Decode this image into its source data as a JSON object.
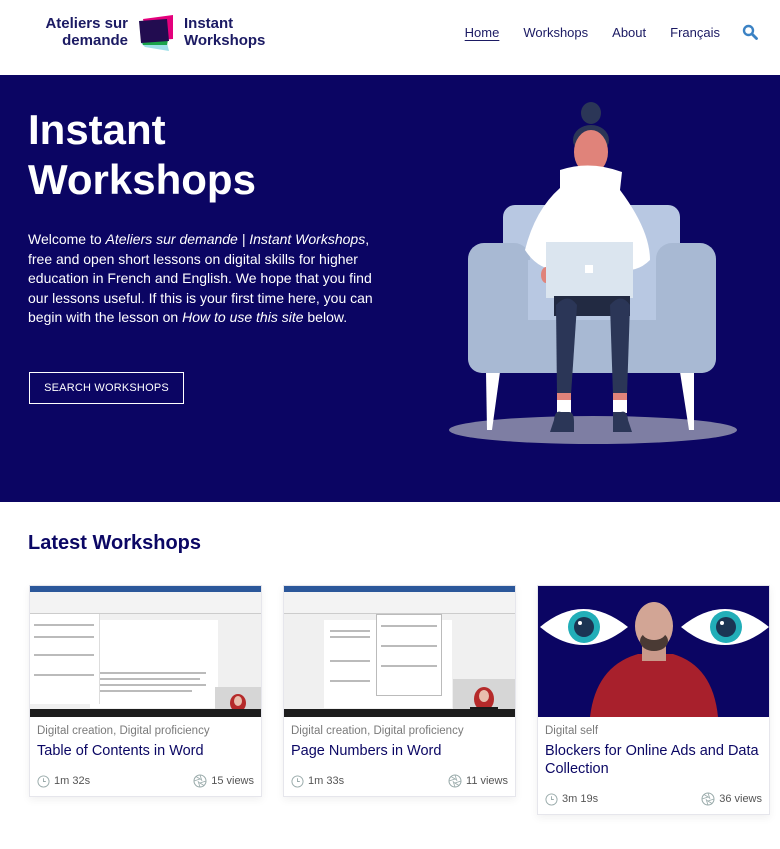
{
  "header": {
    "logo_left_line1": "Ateliers sur",
    "logo_left_line2": "demande",
    "logo_right_line1": "Instant",
    "logo_right_line2": "Workshops",
    "nav": [
      {
        "label": "Home",
        "active": true
      },
      {
        "label": "Workshops",
        "active": false
      },
      {
        "label": "About",
        "active": false
      },
      {
        "label": "Français",
        "active": false
      }
    ],
    "search_icon": "search-icon"
  },
  "hero": {
    "title_line1": "Instant",
    "title_line2": "Workshops",
    "text": {
      "p1": "Welcome to ",
      "p2_em": "Ateliers sur demande | Instant Workshops",
      "p3": ", free and open short lessons on digital skills for higher education in French and English. We hope that you find our lessons useful. If this is your first time here, you can begin with the lesson on ",
      "p4_em": "How to use this site",
      "p5": " below."
    },
    "button_label": "SEARCH WORKSHOPS",
    "colors": {
      "background": "#0b0563",
      "chair": "#a8b9d3",
      "hoodie": "#ffffff",
      "skin": "#e0837a",
      "pants": "#2b3657"
    }
  },
  "latest": {
    "title": "Latest Workshops",
    "cards": [
      {
        "categories": "Digital creation, Digital proficiency",
        "title": "Table of Contents in Word",
        "duration": "1m 32s",
        "views": "15 views"
      },
      {
        "categories": "Digital creation, Digital proficiency",
        "title": "Page Numbers in Word",
        "duration": "1m 33s",
        "views": "11 views"
      },
      {
        "categories": "Digital self",
        "title": "Blockers for Online Ads and Data Collection",
        "duration": "3m 19s",
        "views": "36 views"
      }
    ]
  },
  "colors": {
    "brand_navy": "#0b0563",
    "link_blue": "#3b82c4",
    "logo_pink": "#e4007c",
    "logo_green": "#1aa34a",
    "logo_cyan": "#9ee0e8"
  }
}
